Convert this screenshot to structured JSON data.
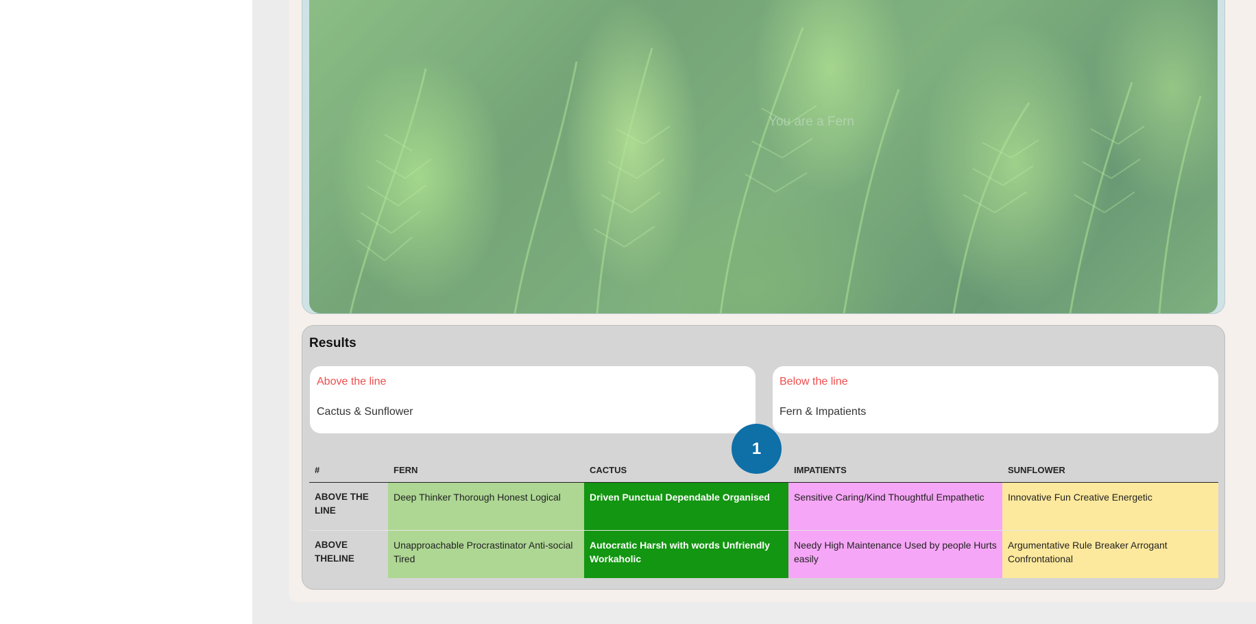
{
  "hero": {
    "result_text": "You are a Fern"
  },
  "results": {
    "title": "Results",
    "above": {
      "label": "Above the line",
      "value": "Cactus & Sunflower"
    },
    "below": {
      "label": "Below the line",
      "value": "Fern & Impatients"
    },
    "step_badge": "1",
    "table": {
      "headers": [
        "#",
        "FERN",
        "CACTUS",
        "IMPATIENTS",
        "SUNFLOWER"
      ],
      "rows": [
        {
          "label": "ABOVE THE LINE",
          "fern": "Deep Thinker Thorough Honest Logical",
          "cactus": "Driven Punctual Dependable Organised",
          "impatients": "Sensitive Caring/Kind Thoughtful Empathetic",
          "sunflower": "Innovative Fun Creative Energetic"
        },
        {
          "label": "ABOVE THELINE",
          "fern": "Unapproachable Procrastinator Anti-social Tired",
          "cactus": "Autocratic Harsh with words Unfriendly Workaholic",
          "impatients": "Needy High Maintenance Used by people Hurts easily",
          "sunflower": "Argumentative Rule Breaker Arrogant Confrontational"
        }
      ]
    }
  },
  "colors": {
    "fern": "#add793",
    "cactus": "#139611",
    "impatients": "#f6a6f6",
    "sunflower": "#fde99d",
    "accent_red": "#ee4d4d",
    "badge_blue": "#0f6fa7"
  }
}
